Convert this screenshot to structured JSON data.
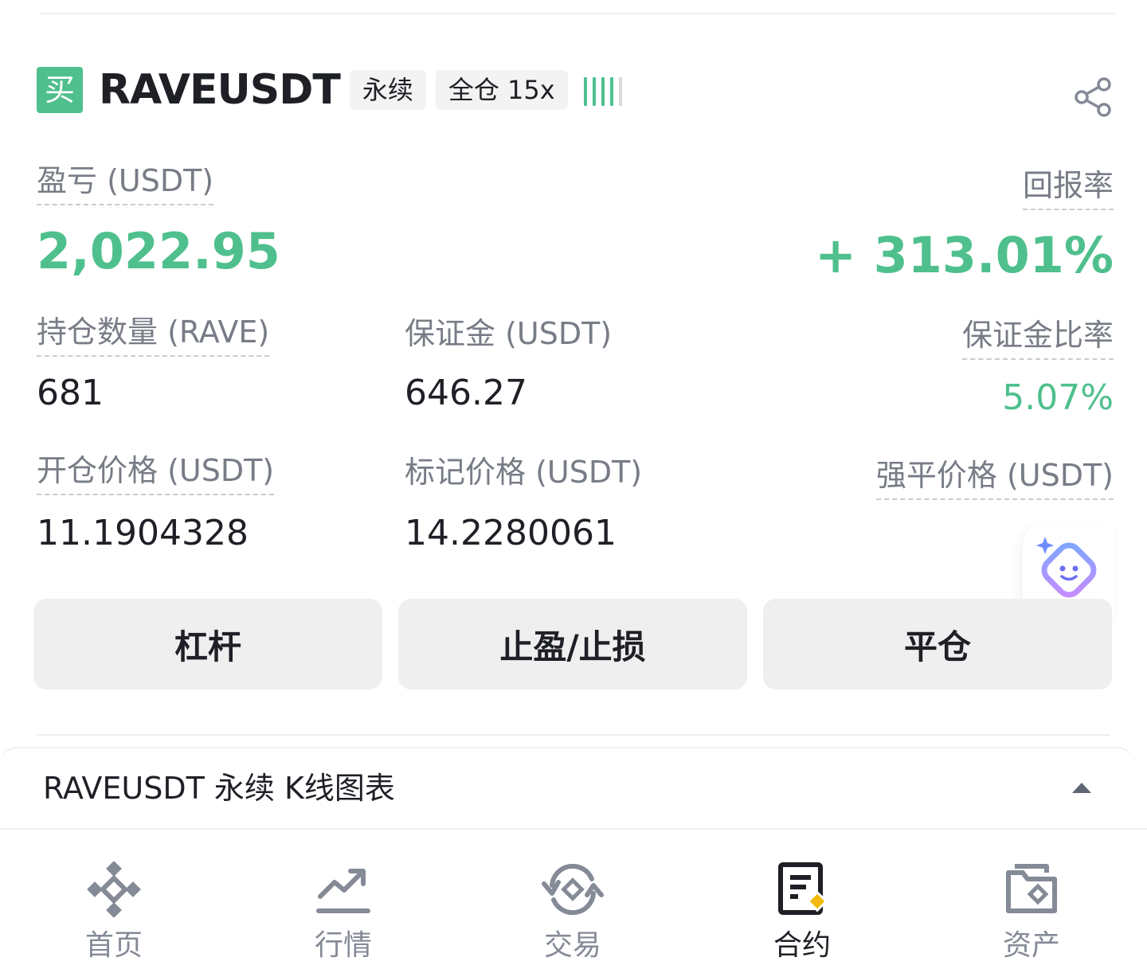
{
  "header": {
    "side_badge": "买",
    "symbol": "RAVEUSDT",
    "contract_type": "永续",
    "margin_mode": "全仓 15x"
  },
  "pnl": {
    "label": "盈亏 (USDT)",
    "value": "2,022.95",
    "roi_label": "回报率",
    "roi_value": "+ 313.01%"
  },
  "stats": {
    "position_size_label": "持仓数量 (RAVE)",
    "position_size_value": "681",
    "margin_label": "保证金 (USDT)",
    "margin_value": "646.27",
    "margin_ratio_label": "保证金比率",
    "margin_ratio_value": "5.07%",
    "entry_price_label": "开仓价格 (USDT)",
    "entry_price_value": "11.1904328",
    "mark_price_label": "标记价格 (USDT)",
    "mark_price_value": "14.2280061",
    "liq_price_label": "强平价格 (USDT)",
    "liq_price_value": ""
  },
  "actions": {
    "leverage": "杠杆",
    "tp_sl": "止盈/止损",
    "close": "平仓"
  },
  "chart_section": {
    "title": "RAVEUSDT 永续 K线图表"
  },
  "nav": {
    "home": "首页",
    "markets": "行情",
    "trade": "交易",
    "futures": "合约",
    "assets": "资产",
    "active": "futures"
  },
  "colors": {
    "profit_green": "#4fc08d",
    "accent_yellow": "#f0b90b",
    "text_primary": "#1e2026",
    "text_secondary": "#777c86"
  },
  "icons": {
    "share": "share-icon",
    "assistant": "ai-assistant-icon",
    "collapse": "caret-up-icon",
    "home": "binance-logo-icon",
    "markets": "trend-chart-icon",
    "trade": "swap-exchange-icon",
    "futures": "contract-document-icon",
    "assets": "wallet-icon"
  }
}
